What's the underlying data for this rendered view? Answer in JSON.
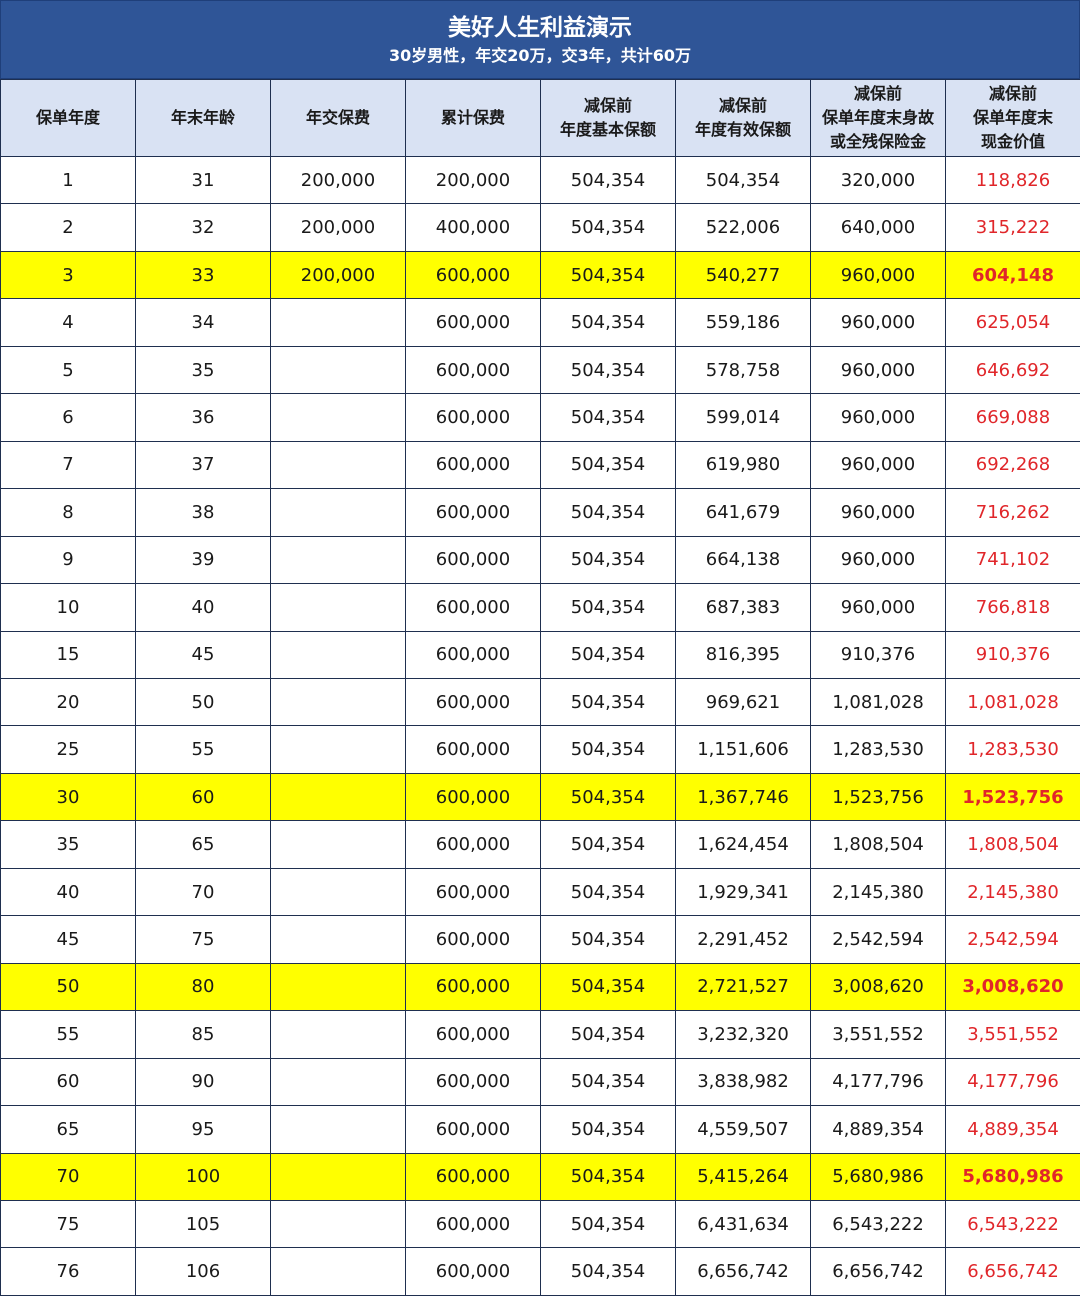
{
  "title": "美好人生利益演示",
  "subtitle": "30岁男性，年交20万，交3年，共计60万",
  "colors": {
    "header_bg": "#2f5597",
    "column_header_bg": "#d9e2f3",
    "highlight": "#ffff00",
    "cash_value": "#e0262a"
  },
  "columns": [
    {
      "lines": [
        "保单年度"
      ]
    },
    {
      "lines": [
        "年末年龄"
      ]
    },
    {
      "lines": [
        "年交保费"
      ]
    },
    {
      "lines": [
        "累计保费"
      ]
    },
    {
      "lines": [
        "减保前",
        "年度基本保额"
      ]
    },
    {
      "lines": [
        "减保前",
        "年度有效保额"
      ]
    },
    {
      "lines": [
        "减保前",
        "保单年度末身故",
        "或全残保险金"
      ]
    },
    {
      "lines": [
        "减保前",
        "保单年度末",
        "现金价值"
      ]
    }
  ],
  "rows": [
    {
      "highlight": false,
      "cells": [
        "1",
        "31",
        "200,000",
        "200,000",
        "504,354",
        "504,354",
        "320,000",
        "118,826"
      ]
    },
    {
      "highlight": false,
      "cells": [
        "2",
        "32",
        "200,000",
        "400,000",
        "504,354",
        "522,006",
        "640,000",
        "315,222"
      ]
    },
    {
      "highlight": true,
      "cells": [
        "3",
        "33",
        "200,000",
        "600,000",
        "504,354",
        "540,277",
        "960,000",
        "604,148"
      ]
    },
    {
      "highlight": false,
      "cells": [
        "4",
        "34",
        "",
        "600,000",
        "504,354",
        "559,186",
        "960,000",
        "625,054"
      ]
    },
    {
      "highlight": false,
      "cells": [
        "5",
        "35",
        "",
        "600,000",
        "504,354",
        "578,758",
        "960,000",
        "646,692"
      ]
    },
    {
      "highlight": false,
      "cells": [
        "6",
        "36",
        "",
        "600,000",
        "504,354",
        "599,014",
        "960,000",
        "669,088"
      ]
    },
    {
      "highlight": false,
      "cells": [
        "7",
        "37",
        "",
        "600,000",
        "504,354",
        "619,980",
        "960,000",
        "692,268"
      ]
    },
    {
      "highlight": false,
      "cells": [
        "8",
        "38",
        "",
        "600,000",
        "504,354",
        "641,679",
        "960,000",
        "716,262"
      ]
    },
    {
      "highlight": false,
      "cells": [
        "9",
        "39",
        "",
        "600,000",
        "504,354",
        "664,138",
        "960,000",
        "741,102"
      ]
    },
    {
      "highlight": false,
      "cells": [
        "10",
        "40",
        "",
        "600,000",
        "504,354",
        "687,383",
        "960,000",
        "766,818"
      ]
    },
    {
      "highlight": false,
      "cells": [
        "15",
        "45",
        "",
        "600,000",
        "504,354",
        "816,395",
        "910,376",
        "910,376"
      ]
    },
    {
      "highlight": false,
      "cells": [
        "20",
        "50",
        "",
        "600,000",
        "504,354",
        "969,621",
        "1,081,028",
        "1,081,028"
      ]
    },
    {
      "highlight": false,
      "cells": [
        "25",
        "55",
        "",
        "600,000",
        "504,354",
        "1,151,606",
        "1,283,530",
        "1,283,530"
      ]
    },
    {
      "highlight": true,
      "cells": [
        "30",
        "60",
        "",
        "600,000",
        "504,354",
        "1,367,746",
        "1,523,756",
        "1,523,756"
      ]
    },
    {
      "highlight": false,
      "cells": [
        "35",
        "65",
        "",
        "600,000",
        "504,354",
        "1,624,454",
        "1,808,504",
        "1,808,504"
      ]
    },
    {
      "highlight": false,
      "cells": [
        "40",
        "70",
        "",
        "600,000",
        "504,354",
        "1,929,341",
        "2,145,380",
        "2,145,380"
      ]
    },
    {
      "highlight": false,
      "cells": [
        "45",
        "75",
        "",
        "600,000",
        "504,354",
        "2,291,452",
        "2,542,594",
        "2,542,594"
      ]
    },
    {
      "highlight": true,
      "cells": [
        "50",
        "80",
        "",
        "600,000",
        "504,354",
        "2,721,527",
        "3,008,620",
        "3,008,620"
      ]
    },
    {
      "highlight": false,
      "cells": [
        "55",
        "85",
        "",
        "600,000",
        "504,354",
        "3,232,320",
        "3,551,552",
        "3,551,552"
      ]
    },
    {
      "highlight": false,
      "cells": [
        "60",
        "90",
        "",
        "600,000",
        "504,354",
        "3,838,982",
        "4,177,796",
        "4,177,796"
      ]
    },
    {
      "highlight": false,
      "cells": [
        "65",
        "95",
        "",
        "600,000",
        "504,354",
        "4,559,507",
        "4,889,354",
        "4,889,354"
      ]
    },
    {
      "highlight": true,
      "cells": [
        "70",
        "100",
        "",
        "600,000",
        "504,354",
        "5,415,264",
        "5,680,986",
        "5,680,986"
      ]
    },
    {
      "highlight": false,
      "cells": [
        "75",
        "105",
        "",
        "600,000",
        "504,354",
        "6,431,634",
        "6,543,222",
        "6,543,222"
      ]
    },
    {
      "highlight": false,
      "cells": [
        "76",
        "106",
        "",
        "600,000",
        "504,354",
        "6,656,742",
        "6,656,742",
        "6,656,742"
      ]
    }
  ]
}
